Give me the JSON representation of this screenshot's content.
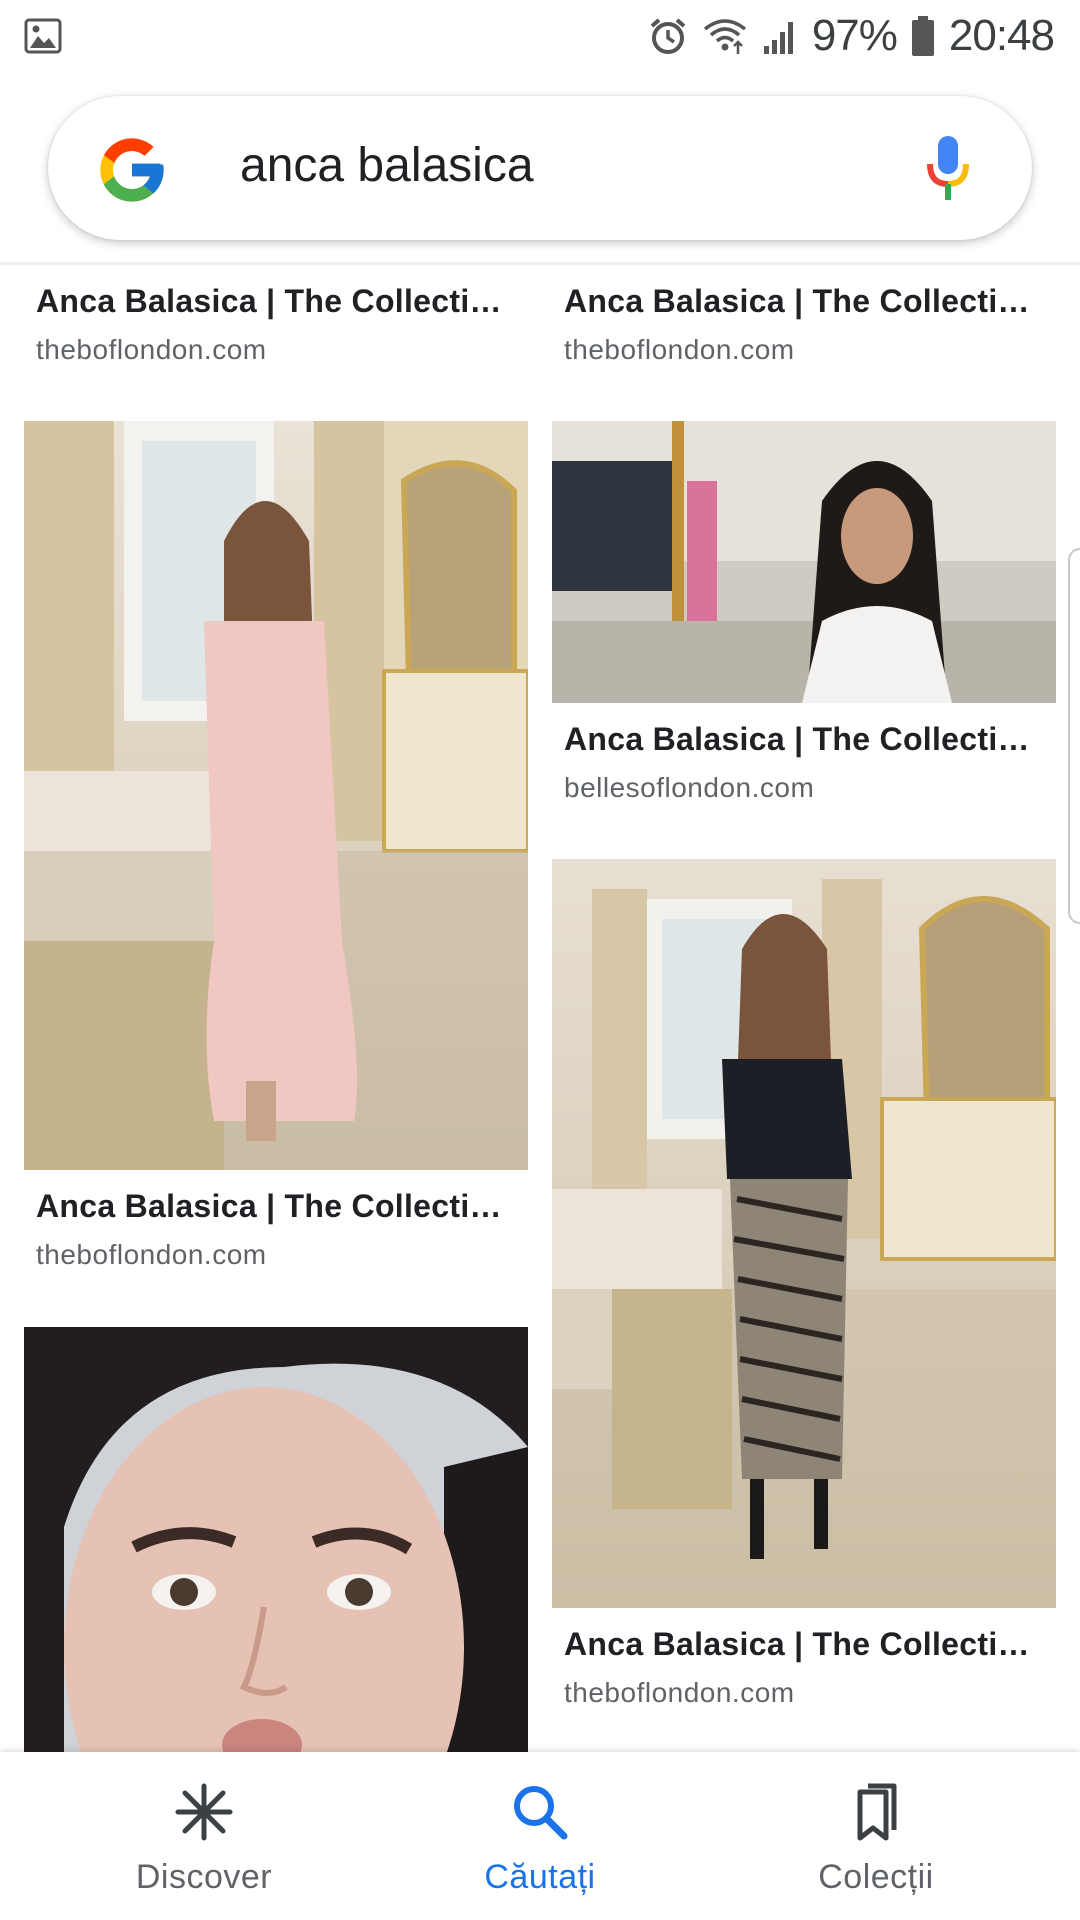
{
  "status_bar": {
    "battery": "97%",
    "time": "20:48",
    "icons": [
      "image-icon",
      "alarm-icon",
      "wifi-icon",
      "signal-icon",
      "battery-icon"
    ]
  },
  "search": {
    "query": "anca balasica",
    "icons": [
      "google-logo",
      "mic-icon"
    ]
  },
  "results": [
    {
      "title": "Anca Balasica | The Collection ...",
      "domain": "theboflondon.com"
    },
    {
      "title": "Anca Balasica | The Collection ...",
      "domain": "theboflondon.com"
    },
    {
      "title": "",
      "domain": ""
    },
    {
      "title": "Anca Balasica | The Collection ...",
      "domain": "bellesoflondon.com"
    },
    {
      "title": "Anca Balasica | The Collection ...",
      "domain": "theboflondon.com"
    },
    {
      "title": "",
      "domain": ""
    },
    {
      "title": "Anca Balasica | The Collection ...",
      "domain": "theboflondon.com"
    }
  ],
  "bottom_nav": {
    "items": [
      {
        "label": "Discover",
        "icon": "asterisk-icon"
      },
      {
        "label": "Căutați",
        "icon": "search-icon"
      },
      {
        "label": "Colecții",
        "icon": "collections-icon"
      }
    ],
    "active_index": 1
  },
  "colors": {
    "accent": "#1a73e8",
    "text": "#202124",
    "secondary_text": "#5f6368"
  }
}
